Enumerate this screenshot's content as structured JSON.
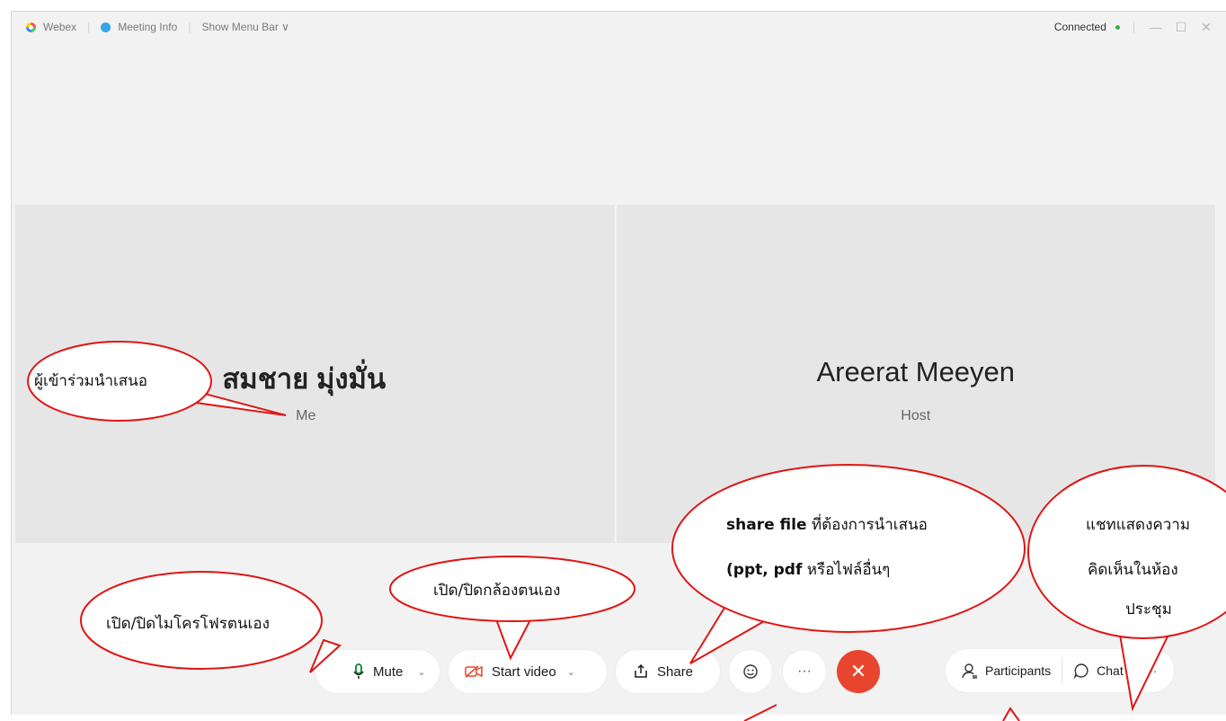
{
  "titlebar": {
    "app_name": "Webex",
    "meeting_info": "Meeting Info",
    "show_menu_bar": "Show Menu Bar",
    "status": "Connected",
    "status_color": "#2db44a"
  },
  "tiles": [
    {
      "name": "สมชาย มุ่งมั่น",
      "role": "Me"
    },
    {
      "name": "Areerat Meeyen",
      "role": "Host"
    }
  ],
  "controls": {
    "mute": "Mute",
    "start_video": "Start video",
    "share": "Share",
    "participants": "Participants",
    "chat": "Chat",
    "more": "···",
    "end_color": "#e8452f"
  },
  "annotations": {
    "presenter": "ผู้เข้าร่วมนำเสนอ",
    "mic": "เปิด/ปิดไมโครโฟรตนเอง",
    "camera": "เปิด/ปิดกล้องตนเอง",
    "share_line1_bold": "share file",
    "share_line1_rest": " ที่ต้องการนำเสนอ",
    "share_line2_bold": "(ppt, pdf",
    "share_line2_rest": " หรือไฟล์อื่นๆ",
    "chat_line1": "แชทแสดงความ",
    "chat_line2": "คิดเห็นในห้อง",
    "chat_line3": "ประชุม",
    "callout_color": "#e01515"
  }
}
